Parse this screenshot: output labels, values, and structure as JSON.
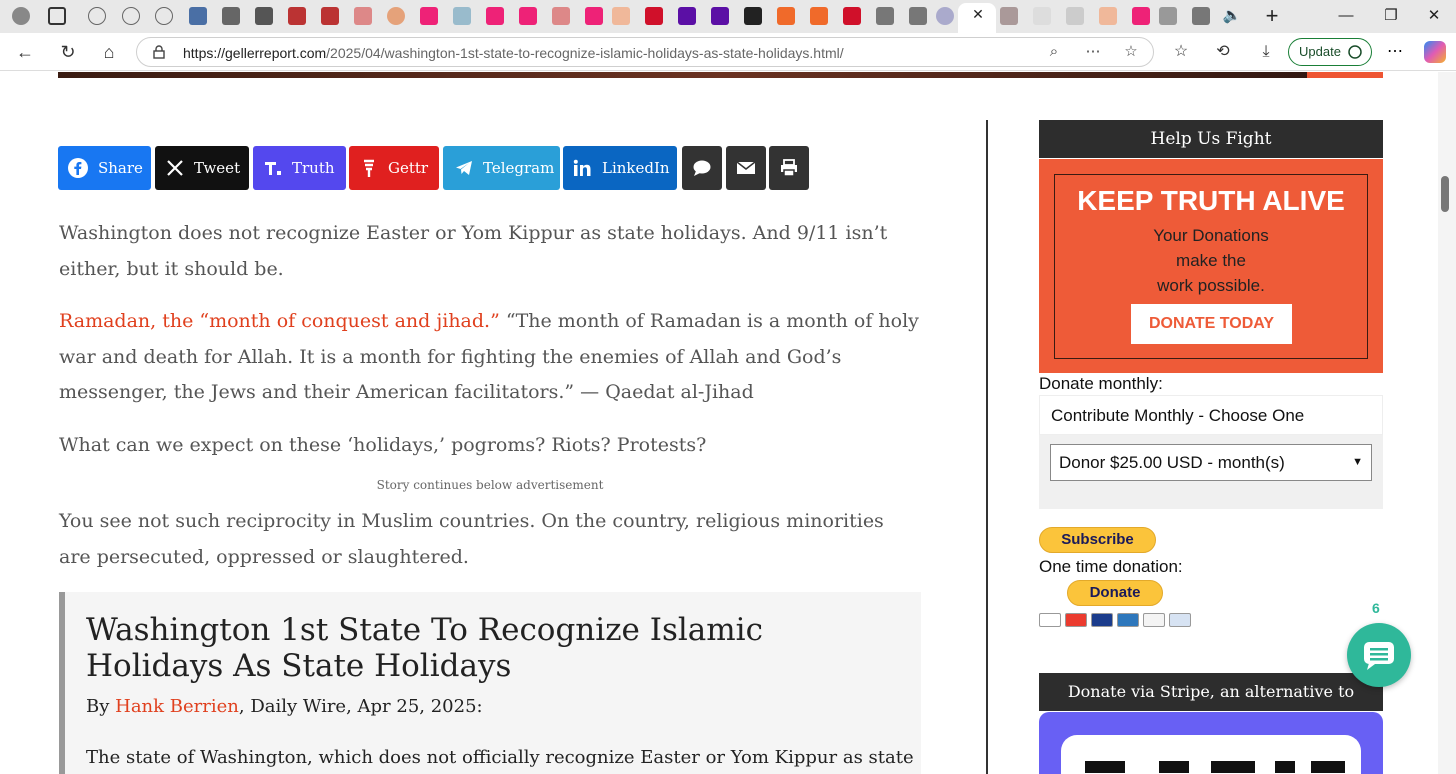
{
  "browser": {
    "url_host": "https://gellerreport.com",
    "url_path": "/2025/04/washington-1st-state-to-recognize-islamic-holidays-as-state-holidays.html/",
    "update_label": "Update"
  },
  "share": {
    "buttons": [
      {
        "label": "Share",
        "color": "#1877f2",
        "icon": "facebook-icon"
      },
      {
        "label": "Tweet",
        "color": "#111111",
        "icon": "x-icon"
      },
      {
        "label": "Truth",
        "color": "#5448ee",
        "icon": "truth-social-icon"
      },
      {
        "label": "Gettr",
        "color": "#e0201f",
        "icon": "gettr-icon"
      },
      {
        "label": "Telegram",
        "color": "#2a9fd8",
        "icon": "telegram-icon"
      },
      {
        "label": "LinkedIn",
        "color": "#0a66c2",
        "icon": "linkedin-icon"
      }
    ],
    "extra_icons": [
      "comment-icon",
      "email-icon",
      "print-icon"
    ],
    "extra_color": "#333333"
  },
  "article": {
    "p1": "Washington does not recognize Easter or Yom Kippur as state holidays. And 9/11 isn’t either, but it should be.",
    "p2_link": "Ramadan, the “month of conquest and jihad.”",
    "p2_rest": " “The month of Ramadan is a month of holy war and death for Allah. It is a month for fighting the enemies of Allah and God’s messenger, the Jews and their American facilitators.” — Qaedat al-Jihad",
    "p3": "What can we expect on these ‘holidays,’ pogroms? Riots? Protests?",
    "ad_note": "Story continues below advertisement",
    "p4": "You see not such reciprocity in Muslim countries. On the country, religious minorities are persecuted, oppressed or slaughtered."
  },
  "quote": {
    "title": "Washington 1st State To Recognize Islamic Holidays As State Holidays",
    "by": "By ",
    "author": "Hank Berrien",
    "source": ", Daily Wire, Apr 25, 2025:",
    "body": "The state of Washington, which does not officially recognize Easter or Yom Kippur as state"
  },
  "sidebar": {
    "help_title": "Help Us Fight",
    "banner_big": "KEEP TRUTH ALIVE",
    "banner_line1": "Your Donations",
    "banner_line2": "make the",
    "banner_line3": "work possible.",
    "donate_today": "DONATE TODAY",
    "donate_monthly_label": "Donate monthly:",
    "choose_one": "Contribute Monthly - Choose One",
    "selected_amount": "Donor $25.00 USD - month(s)",
    "subscribe": "Subscribe",
    "one_time_label": "One time donation:",
    "donate": "Donate",
    "stripe_title": "Donate via Stripe, an alternative to Paypal"
  },
  "chat": {
    "count": "6"
  }
}
